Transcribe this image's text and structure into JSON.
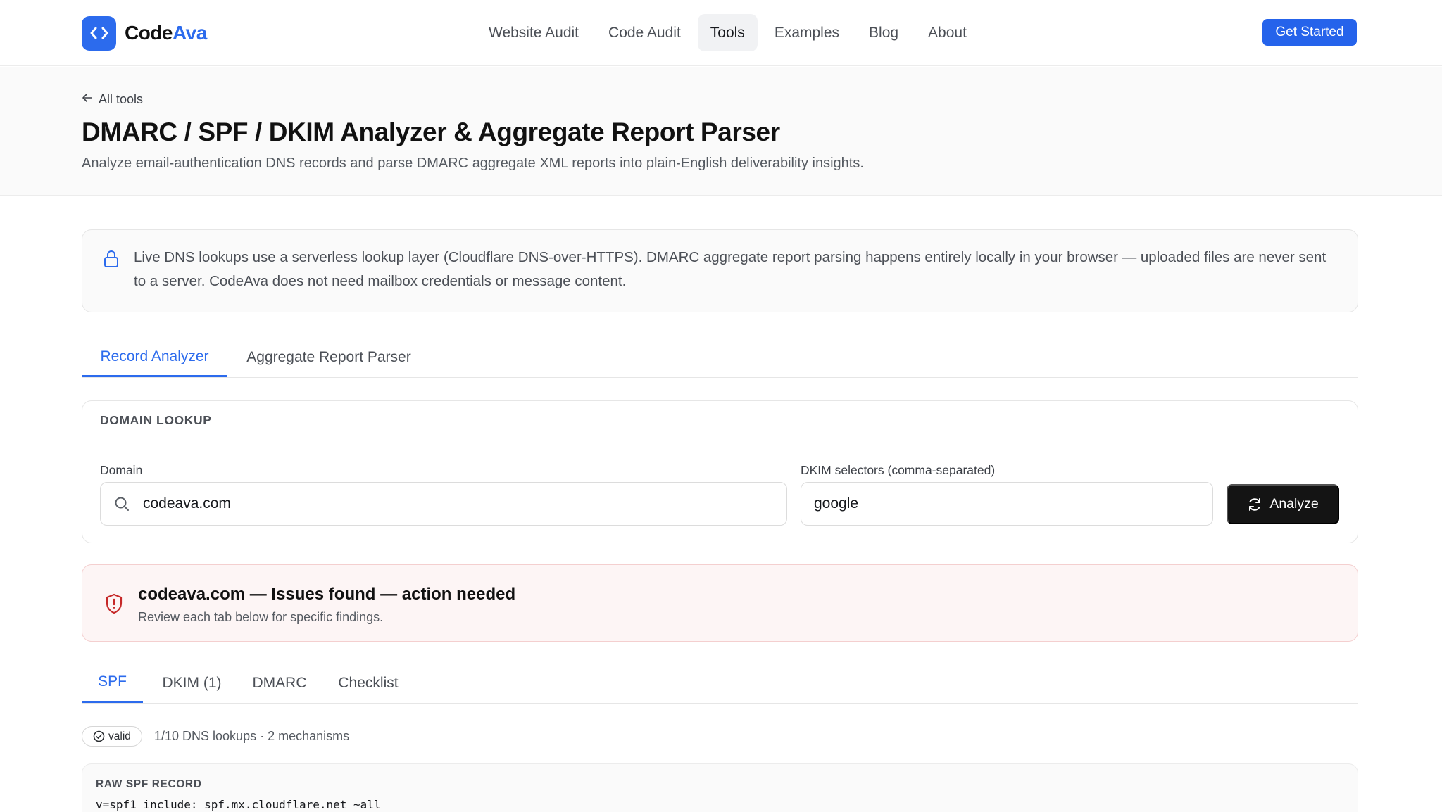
{
  "colors": {
    "accent": "#2c6bed",
    "cta": "#2563eb",
    "danger": "#c62828",
    "dark_button": "#141414"
  },
  "brand": {
    "name_part1": "Code",
    "name_part2": "Ava",
    "icon": "code-brackets-icon"
  },
  "nav": {
    "links": [
      {
        "label": "Website Audit"
      },
      {
        "label": "Code Audit"
      },
      {
        "label": "Tools",
        "active": true
      },
      {
        "label": "Examples"
      },
      {
        "label": "Blog"
      },
      {
        "label": "About"
      }
    ],
    "cta_label": "Get Started"
  },
  "hero": {
    "back_label": "All tools",
    "back_icon": "arrow-left-icon",
    "title": "DMARC / SPF / DKIM Analyzer & Aggregate Report Parser",
    "subtitle": "Analyze email-authentication DNS records and parse DMARC aggregate XML reports into plain-English deliverability insights."
  },
  "notice": {
    "icon": "lock-icon",
    "text": "Live DNS lookups use a serverless lookup layer (Cloudflare DNS-over-HTTPS). DMARC aggregate report parsing happens entirely locally in your browser — uploaded files are never sent to a server. CodeAva does not need mailbox credentials or message content."
  },
  "main_tabs": [
    {
      "label": "Record Analyzer",
      "active": true
    },
    {
      "label": "Aggregate Report Parser",
      "active": false
    }
  ],
  "lookup": {
    "heading": "DOMAIN LOOKUP",
    "domain_label": "Domain",
    "domain_value": "codeava.com",
    "selectors_label": "DKIM selectors (comma-separated)",
    "selectors_value": "google",
    "analyze_label": "Analyze",
    "analyze_icon": "refresh-icon"
  },
  "alert": {
    "icon": "shield-alert-icon",
    "title": "codeava.com — Issues found — action needed",
    "subtitle": "Review each tab below for specific findings."
  },
  "result_tabs": [
    {
      "label": "SPF",
      "active": true
    },
    {
      "label": "DKIM (1)",
      "active": false
    },
    {
      "label": "DMARC",
      "active": false
    },
    {
      "label": "Checklist",
      "active": false
    }
  ],
  "spf": {
    "badge_label": "valid",
    "badge_icon": "check-circle-icon",
    "summary": "1/10 DNS lookups · 2 mechanisms",
    "raw_label": "RAW SPF RECORD",
    "raw_value": "v=spf1 include:_spf.mx.cloudflare.net ~all"
  }
}
